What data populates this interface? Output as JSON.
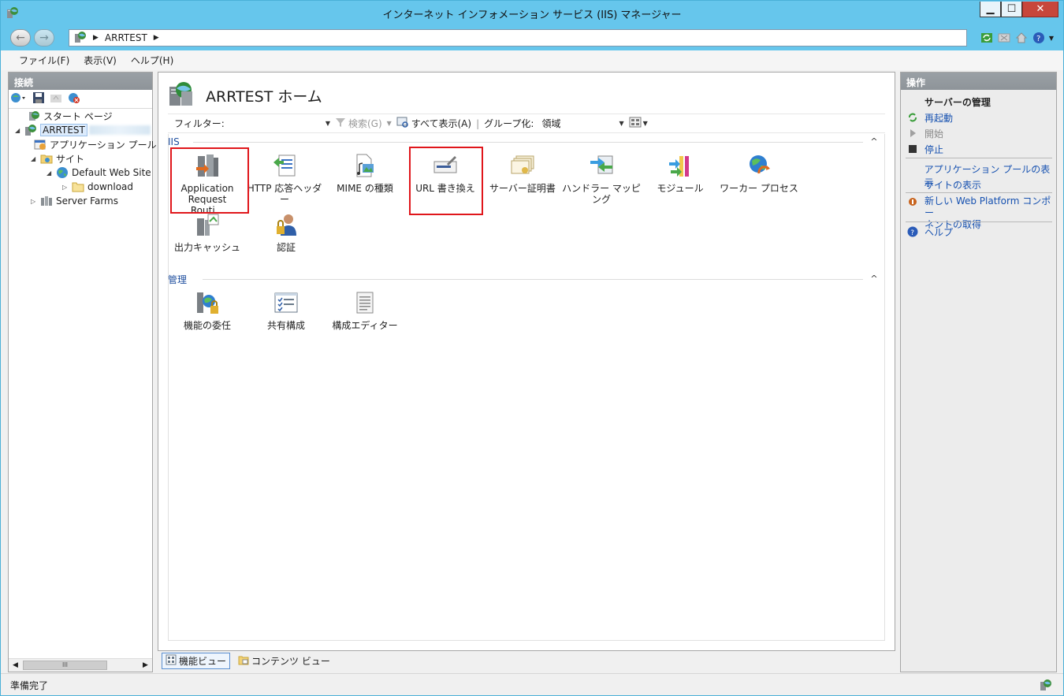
{
  "window": {
    "title": "インターネット インフォメーション サービス (IIS) マネージャー",
    "minimize": "▁",
    "maximize": "☐",
    "close": "✕"
  },
  "address": {
    "crumbs": [
      "ARRTEST"
    ]
  },
  "menu": {
    "file": "ファイル(F)",
    "view": "表示(V)",
    "help": "ヘルプ(H)"
  },
  "connections": {
    "header": "接続",
    "tree": [
      {
        "label": "スタート ページ",
        "icon": "start-page-icon"
      },
      {
        "label": "ARRTEST",
        "icon": "server-icon",
        "selected": true
      },
      {
        "label": "アプリケーション プール",
        "icon": "app-pool-icon"
      },
      {
        "label": "サイト",
        "icon": "sites-folder-icon"
      },
      {
        "label": "Default Web Site",
        "icon": "globe-icon"
      },
      {
        "label": "download",
        "icon": "folder-icon"
      },
      {
        "label": "Server Farms",
        "icon": "server-farms-icon"
      }
    ],
    "scroll_thumb": "III"
  },
  "center": {
    "title": "ARRTEST ホーム",
    "filter_label": "フィルター:",
    "search_label": "検索(G)",
    "show_all_label": "すべて表示(A)",
    "group_by_label": "グループ化:",
    "group_by_value": "領域",
    "groups": [
      {
        "name": "IIS",
        "features": [
          {
            "label": "Application Request Routi...",
            "icon": "arr-icon"
          },
          {
            "label": "HTTP 応答ヘッダー",
            "icon": "http-headers-icon"
          },
          {
            "label": "MIME の種類",
            "icon": "mime-types-icon"
          },
          {
            "label": "URL 書き換え",
            "icon": "url-rewrite-icon"
          },
          {
            "label": "サーバー証明書",
            "icon": "server-certificates-icon"
          },
          {
            "label": "ハンドラー マッピング",
            "icon": "handler-mappings-icon"
          },
          {
            "label": "モジュール",
            "icon": "modules-icon"
          },
          {
            "label": "ワーカー プロセス",
            "icon": "worker-processes-icon"
          },
          {
            "label": "出力キャッシュ",
            "icon": "output-cache-icon"
          },
          {
            "label": "認証",
            "icon": "authentication-icon"
          }
        ]
      },
      {
        "name": "管理",
        "features": [
          {
            "label": "機能の委任",
            "icon": "feature-delegation-icon"
          },
          {
            "label": "共有構成",
            "icon": "shared-configuration-icon"
          },
          {
            "label": "構成エディター",
            "icon": "configuration-editor-icon"
          }
        ]
      }
    ],
    "collapse_glyph": "^"
  },
  "view_tabs": {
    "features_view": "機能ビュー",
    "content_view": "コンテンツ ビュー"
  },
  "actions": {
    "header": "操作",
    "section_title": "サーバーの管理",
    "restart": "再起動",
    "start": "開始",
    "stop": "停止",
    "view_app_pools": "アプリケーション プールの表示",
    "view_sites": "サイトの表示",
    "web_platform_line1": "新しい Web Platform コンポー",
    "web_platform_line2": "ネントの取得",
    "help": "ヘルプ"
  },
  "status": {
    "text": "準備完了"
  },
  "colors": {
    "title_bar": "#66c6ec",
    "link": "#1651b0",
    "highlight": "#e0161b",
    "group_header": "#1f4f9f"
  }
}
